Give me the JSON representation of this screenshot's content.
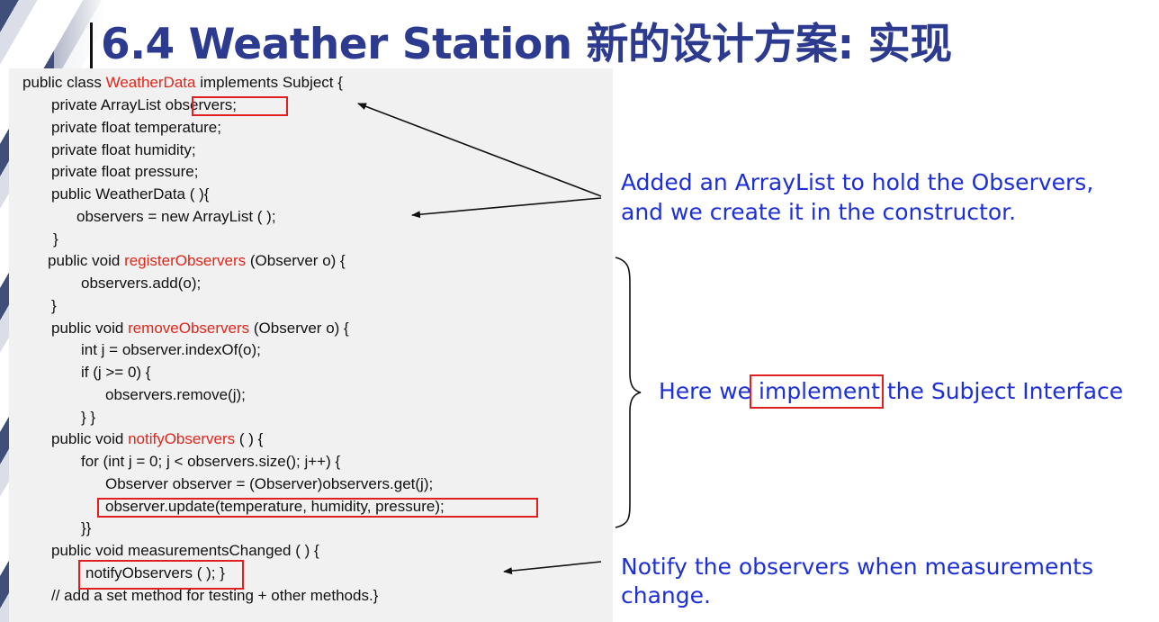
{
  "title": "6.4 Weather Station 新的设计方案: 实现",
  "code": {
    "l1_a": "public class ",
    "l1_b": "WeatherData",
    "l1_c": " implements Subject {",
    "l2_a": "private ArrayList ",
    "l2_b": "observers;",
    "l3": "private float temperature;",
    "l4": "private float humidity;",
    "l5": "private float pressure;",
    "l6": "public WeatherData ( ){",
    "l7": "observers = new ArrayList ( );",
    "l8": "}",
    "l9_a": "public void ",
    "l9_b": "registerObservers",
    "l9_c": " (Observer o) {",
    "l10": "observers.add(o);",
    "l11": "}",
    "l12_a": "public void ",
    "l12_b": "removeObservers",
    "l12_c": " (Observer o) {",
    "l13": "int j = observer.indexOf(o);",
    "l14": "if (j >= 0) {",
    "l15": "observers.remove(j);",
    "l16": "} }",
    "l17_a": "public void ",
    "l17_b": "notifyObservers",
    "l17_c": " ( ) {",
    "l18": "for (int j = 0; j < observers.size(); j++) {",
    "l19": "Observer observer = (Observer)observers.get(j);",
    "l20": "observer.update(temperature, humidity, pressure);",
    "l21": "}}",
    "l22": "public void measurementsChanged ( ) {",
    "l23_a": "notifyObservers ( );",
    "l23_b": " }",
    "l24": "// add a set method for testing + other methods.}"
  },
  "annotations": {
    "a1_line1": "Added an ArrayList to hold the Observers,",
    "a1_line2": "and we create it in the constructor.",
    "a2_a": "Here we ",
    "a2_b": "implement",
    "a2_c": " the Subject Interface",
    "a3_line1": "Notify the observers when measurements",
    "a3_line2": "change."
  },
  "colors": {
    "title": "#2c3a8f",
    "keyword_red": "#e0251b",
    "annotation_blue": "#1d2fd6",
    "highlight_box": "#e02020",
    "code_background": "#f1f1f1"
  }
}
